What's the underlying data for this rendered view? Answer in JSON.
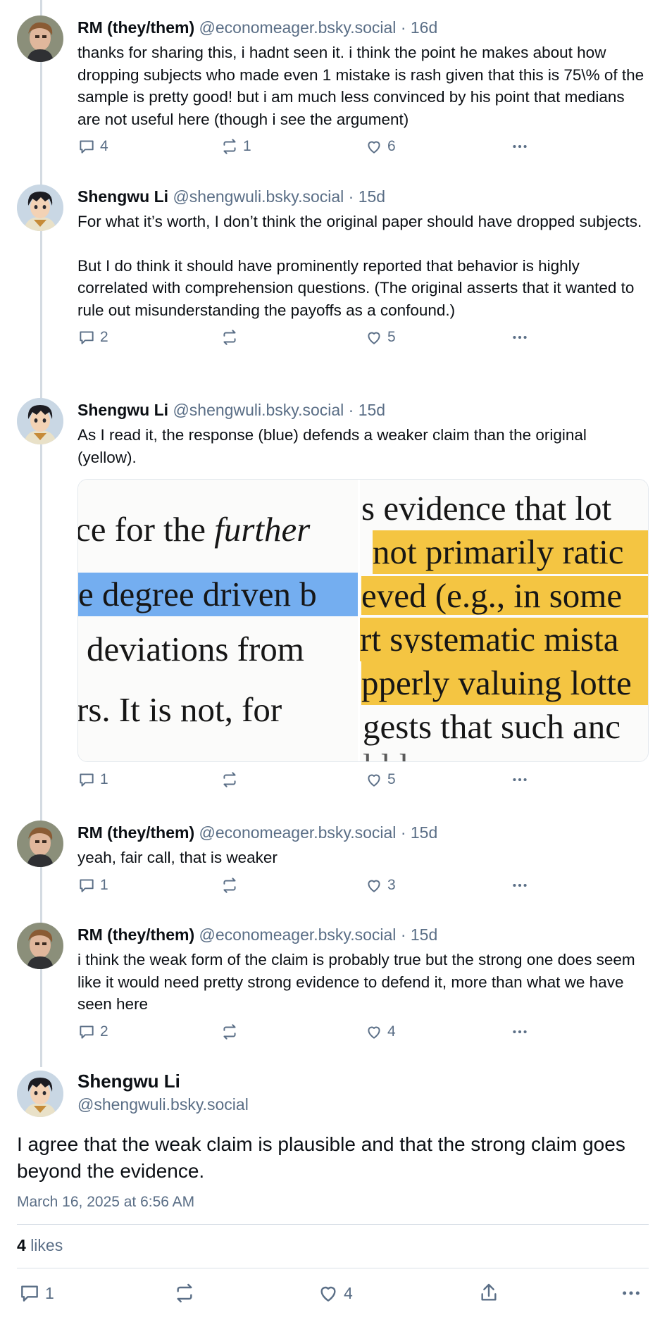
{
  "posts": [
    {
      "name": "RM (they/them)",
      "handle": "@economeager.bsky.social",
      "time": "16d",
      "paragraphs": [
        "thanks for sharing this, i hadnt seen it. i think the point he makes about how dropping subjects who made even 1 mistake is rash given that this is 75\\% of the sample is pretty good! but i am much less convinced by his point that medians are not useful here (though i see the argument)"
      ],
      "replies": "4",
      "reposts": "1",
      "likes": "6"
    },
    {
      "name": "Shengwu Li",
      "handle": "@shengwuli.bsky.social",
      "time": "15d",
      "paragraphs": [
        "For what it’s worth, I don’t think the original paper should have dropped subjects.",
        "But I do think it should have prominently reported that behavior is highly correlated with comprehension questions. (The original asserts that it wanted to rule out misunderstanding the payoffs as a confound.)"
      ],
      "replies": "2",
      "reposts": "",
      "likes": "5"
    },
    {
      "name": "Shengwu Li",
      "handle": "@shengwuli.bsky.social",
      "time": "15d",
      "paragraphs": [
        "As I read it, the response (blue) defends a weaker claim than the original (yellow)."
      ],
      "replies": "1",
      "reposts": "",
      "likes": "5",
      "embed": {
        "left_lines": [
          "ce for the ",
          "further",
          "e degree driven b",
          "deviations from",
          "rs.  It is not, for"
        ],
        "right_lines": [
          "s evidence that lot",
          "not primarily ratic",
          "eved (e.g., in some",
          "rt systematic mista",
          "pperly valuing lotte",
          "gests that such anc",
          "     l  l      l"
        ]
      }
    },
    {
      "name": "RM (they/them)",
      "handle": "@economeager.bsky.social",
      "time": "15d",
      "paragraphs": [
        "yeah, fair call, that is weaker"
      ],
      "replies": "1",
      "reposts": "",
      "likes": "3"
    },
    {
      "name": "RM (they/them)",
      "handle": "@economeager.bsky.social",
      "time": "15d",
      "paragraphs": [
        "i think the weak form of the claim is probably true but the strong one does seem like it would need pretty strong evidence to defend it, more than what we have seen here"
      ],
      "replies": "2",
      "reposts": "",
      "likes": "4"
    }
  ],
  "main": {
    "name": "Shengwu Li",
    "handle": "@shengwuli.bsky.social",
    "text": "I agree that the weak claim is plausible and that the strong claim goes beyond the evidence.",
    "date": "March 16, 2025 at 6:56 AM",
    "likes_count": "4",
    "likes_label": "likes",
    "replies": "1",
    "likes": "4"
  },
  "separator": "·",
  "colors": {
    "meta": "#5a6e86",
    "thread_line": "#d4dbe2",
    "highlight_blue": "#74aef0",
    "highlight_yellow": "#f4c542"
  }
}
